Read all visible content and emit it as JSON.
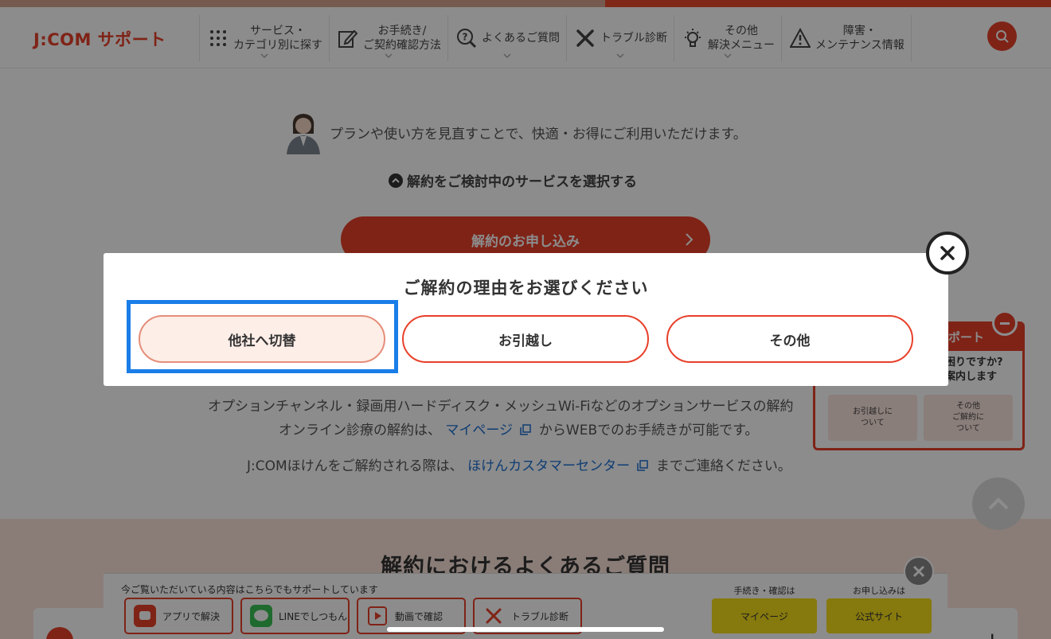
{
  "header": {
    "logo": "J:COM サポート",
    "nav": [
      {
        "label": "サービス・\nカテゴリ別に探す",
        "icon": "grid-icon"
      },
      {
        "label": "お手続き/\nご契約確認方法",
        "icon": "edit-icon"
      },
      {
        "label": "よくあるご質問",
        "icon": "question-search-icon"
      },
      {
        "label": "トラブル診断",
        "icon": "tools-icon"
      },
      {
        "label": "その他\n解決メニュー",
        "icon": "lightbulb-icon"
      },
      {
        "label": "障害・\nメンテナンス情報",
        "icon": "warning-icon"
      }
    ],
    "search_icon": "search-icon"
  },
  "main": {
    "intro": "プランや使い方を見直すことで、快適・お得にご利用いただけます。",
    "select_service": "解約をご検討中のサービスを選択する",
    "apply_button": "解約のお申し込み",
    "option_text": "オプションチャンネル・録画用ハードディスク・メッシュWi-Fiなどのオプションサービスの解約",
    "online_prefix": "オンライン診療の解約は、",
    "online_link": "マイページ",
    "online_suffix": "からWEBでのお手続きが可能です。",
    "hoken_prefix": "J:COMほけんをご解約される際は、",
    "hoken_link": "ほけんカスタマーセンター",
    "hoken_suffix": "までご連絡ください。"
  },
  "faq": {
    "title": "解約におけるよくあるご質問"
  },
  "side_widget": {
    "title": "サポート",
    "sub_line1": "お困りですか?",
    "sub_line2": "ご案内します",
    "buttons": [
      "お引越しに\nついて",
      "その他\nご解約に\nついて"
    ]
  },
  "support_bar": {
    "title": "今ご覧いただいている内容はこちらでもサポートしています",
    "buttons": [
      {
        "label": "アプリで解決",
        "icon": "jcom-app-icon"
      },
      {
        "label": "LINEでしつもん",
        "icon": "line-icon"
      },
      {
        "label": "動画で確認",
        "icon": "video-play-icon"
      },
      {
        "label": "トラブル診断",
        "icon": "tools-icon"
      }
    ],
    "procedure_label": "手続き・確認は",
    "procedure_button": "マイページ",
    "apply_label": "お申し込みは",
    "apply_button": "公式サイト"
  },
  "modal": {
    "title": "ご解約の理由をお選びください",
    "options": [
      "他社へ切替",
      "お引越し",
      "その他"
    ]
  },
  "colors": {
    "brand": "#e8402a",
    "highlight": "#1a7ee8",
    "yellow": "#f5dc1a"
  }
}
